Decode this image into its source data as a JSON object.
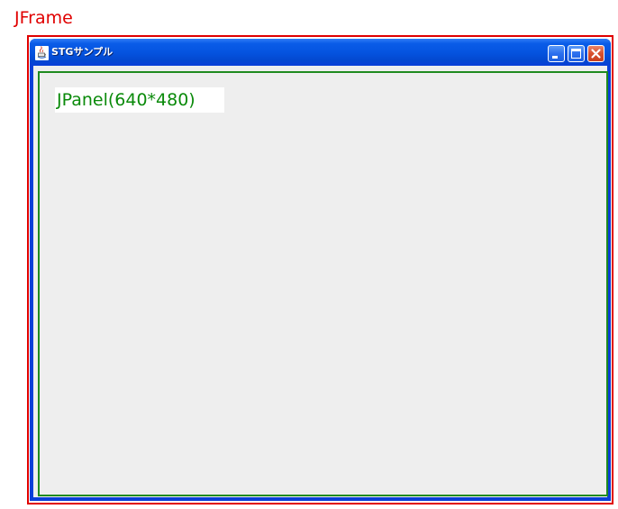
{
  "frame": {
    "label": "JFrame",
    "outline_color": "#e00000"
  },
  "window": {
    "title": "STGサンプル",
    "title_icon": "java-coffee-icon",
    "buttons": [
      {
        "name": "minimize",
        "icon": "minimize-icon"
      },
      {
        "name": "maximize",
        "icon": "maximize-icon"
      },
      {
        "name": "close",
        "icon": "close-icon"
      }
    ],
    "titlebar_color": "#0554e0",
    "content_color": "#eeeeee"
  },
  "panel": {
    "label": "JPanel(640*480)",
    "outline_color": "#1f8a1f",
    "label_color": "#0a8a0a"
  }
}
